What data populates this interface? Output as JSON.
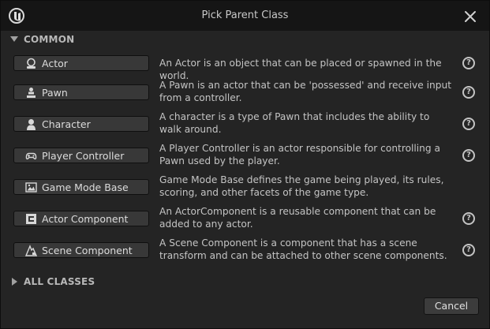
{
  "window": {
    "title": "Pick Parent Class"
  },
  "common_section": {
    "label": "COMMON",
    "classes": [
      {
        "name": "Actor",
        "icon": "actor-icon",
        "description": "An Actor is an object that can be placed or spawned in the world.",
        "has_help": true
      },
      {
        "name": "Pawn",
        "icon": "pawn-icon",
        "description": "A Pawn is an actor that can be 'possessed' and receive input from a controller.",
        "has_help": true
      },
      {
        "name": "Character",
        "icon": "character-icon",
        "description": "A character is a type of Pawn that includes the ability to walk around.",
        "has_help": true
      },
      {
        "name": "Player Controller",
        "icon": "gamepad-icon",
        "description": "A Player Controller is an actor responsible for controlling a Pawn used by the player.",
        "has_help": true
      },
      {
        "name": "Game Mode Base",
        "icon": "game-mode-icon",
        "description": "Game Mode Base defines the game being played, its rules, scoring, and other facets of the game type.",
        "has_help": false
      },
      {
        "name": "Actor Component",
        "icon": "actor-component-icon",
        "description": "An ActorComponent is a reusable component that can be added to any actor.",
        "has_help": true
      },
      {
        "name": "Scene Component",
        "icon": "scene-component-icon",
        "description": "A Scene Component is a component that has a scene transform and can be attached to other scene components.",
        "has_help": true
      }
    ]
  },
  "all_classes_section": {
    "label": "ALL CLASSES"
  },
  "footer": {
    "cancel_label": "Cancel"
  },
  "help_glyph": "?",
  "colors": {
    "background": "#242424",
    "titlebar": "#151515",
    "button": "#383838",
    "text": "#c4c4c4"
  }
}
